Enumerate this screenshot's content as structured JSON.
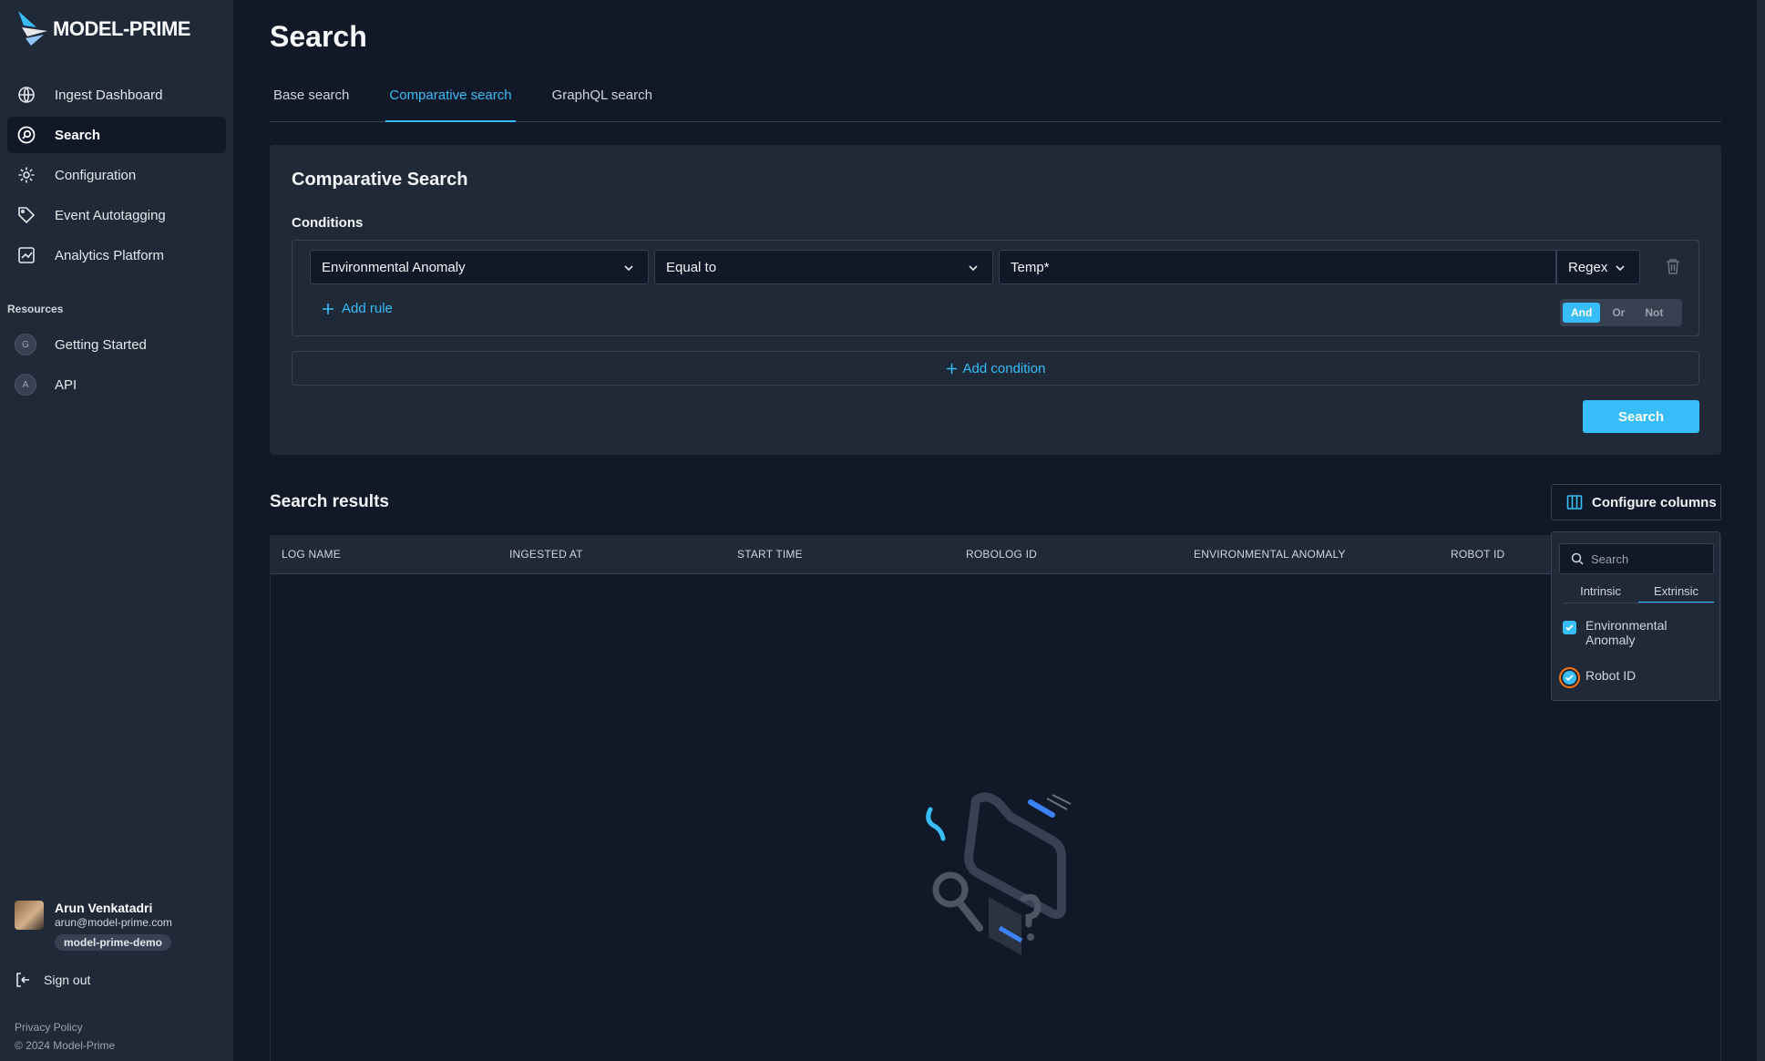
{
  "brand": {
    "name": "MODEL-PRIME"
  },
  "sidebar": {
    "items": [
      {
        "label": "Ingest Dashboard",
        "icon": "globe-icon"
      },
      {
        "label": "Search",
        "icon": "search-icon"
      },
      {
        "label": "Configuration",
        "icon": "gear-icon"
      },
      {
        "label": "Event Autotagging",
        "icon": "tag-icon"
      },
      {
        "label": "Analytics Platform",
        "icon": "chart-icon"
      }
    ],
    "resources_heading": "Resources",
    "resources": [
      {
        "badge": "G",
        "label": "Getting Started"
      },
      {
        "badge": "A",
        "label": "API"
      }
    ]
  },
  "user": {
    "name": "Arun Venkatadri",
    "email": "arun@model-prime.com",
    "org": "model-prime-demo"
  },
  "signout_label": "Sign out",
  "footer": {
    "privacy": "Privacy Policy",
    "copyright": "© 2024 Model-Prime"
  },
  "page": {
    "title": "Search",
    "tabs": [
      {
        "label": "Base search",
        "active": false
      },
      {
        "label": "Comparative search",
        "active": true
      },
      {
        "label": "GraphQL search",
        "active": false
      }
    ]
  },
  "comparative": {
    "title": "Comparative Search",
    "conditions_label": "Conditions",
    "field": "Environmental Anomaly",
    "operator": "Equal to",
    "value": "Temp*",
    "mode": "Regex",
    "add_rule": "Add rule",
    "logic": [
      "And",
      "Or",
      "Not"
    ],
    "logic_selected": "And",
    "add_condition": "Add condition",
    "search_button": "Search"
  },
  "results": {
    "title": "Search results",
    "configure_columns": "Configure columns",
    "columns": [
      "LOG NAME",
      "INGESTED AT",
      "START TIME",
      "ROBOLOG ID",
      "ENVIRONMENTAL ANOMALY",
      "ROBOT ID"
    ]
  },
  "columns_dropdown": {
    "search_placeholder": "Search",
    "tabs": [
      "Intrinsic",
      "Extrinsic"
    ],
    "active_tab": "Extrinsic",
    "options": [
      {
        "line1": "Environmental",
        "line2": "Anomaly",
        "checked": true
      },
      {
        "line1": "Robot ID",
        "line2": "",
        "checked": true
      }
    ]
  },
  "colors": {
    "accent": "#38bdf8",
    "bg": "#111827",
    "panel": "#1f2937",
    "focus_ring": "#f97316"
  }
}
